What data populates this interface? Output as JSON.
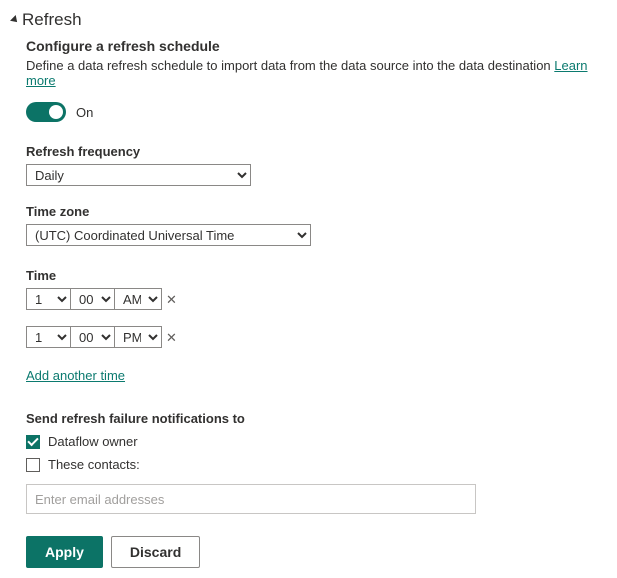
{
  "section": {
    "title": "Refresh",
    "subtitle": "Configure a refresh schedule",
    "description": "Define a data refresh schedule to import data from the data source into the data destination",
    "learn_more": "Learn more"
  },
  "toggle": {
    "enabled": true,
    "label": "On"
  },
  "frequency": {
    "label": "Refresh frequency",
    "value": "Daily"
  },
  "timezone": {
    "label": "Time zone",
    "value": "(UTC) Coordinated Universal Time"
  },
  "time_section": {
    "label": "Time",
    "add_another_label": "Add another time"
  },
  "times": [
    {
      "hour": "1",
      "minute": "00",
      "ampm": "AM"
    },
    {
      "hour": "1",
      "minute": "00",
      "ampm": "PM"
    }
  ],
  "notifications": {
    "label": "Send refresh failure notifications to",
    "owner_label": "Dataflow owner",
    "owner_checked": true,
    "contacts_label": "These contacts:",
    "contacts_checked": false,
    "email_placeholder": "Enter email addresses",
    "email_value": ""
  },
  "buttons": {
    "apply": "Apply",
    "discard": "Discard"
  }
}
